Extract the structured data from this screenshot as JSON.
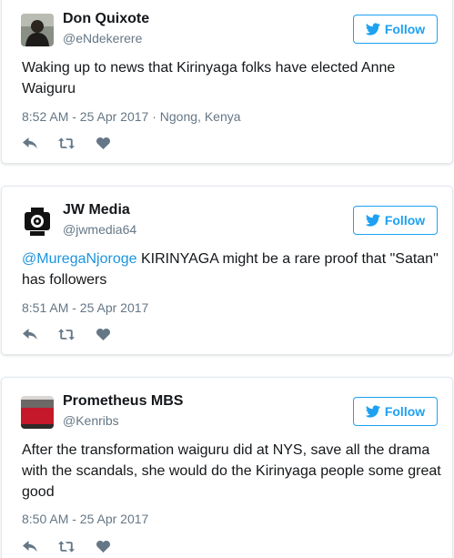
{
  "colors": {
    "accent": "#1da1f2",
    "link": "#1b95e0",
    "secondary_text": "#657786",
    "action_icon": "#657786"
  },
  "follow_label": "Follow",
  "tweets": [
    {
      "name": "Don Quixote",
      "handle": "@eNdekerere",
      "avatar_icon": "person-photo",
      "mention": "",
      "text": "Waking up to news that Kirinyaga folks have elected Anne Waiguru",
      "timestamp": "8:52 AM - 25 Apr 2017",
      "separator": " · ",
      "location": "Ngong, Kenya"
    },
    {
      "name": "JW Media",
      "handle": "@jwmedia64",
      "avatar_icon": "camera-logo",
      "mention": "@MuregaNjoroge",
      "text": " KIRINYAGA might be a rare proof that \"Satan\" has followers",
      "timestamp": "8:51 AM - 25 Apr 2017"
    },
    {
      "name": "Prometheus MBS",
      "handle": "@Kenribs",
      "avatar_icon": "kenya-banner",
      "avatar_text": "KENYA",
      "mention": "",
      "text": "After the transformation waiguru did at NYS, save all the drama with the scandals, she would do the Kirinyaga people some great good",
      "timestamp": "8:50 AM - 25 Apr 2017"
    }
  ]
}
